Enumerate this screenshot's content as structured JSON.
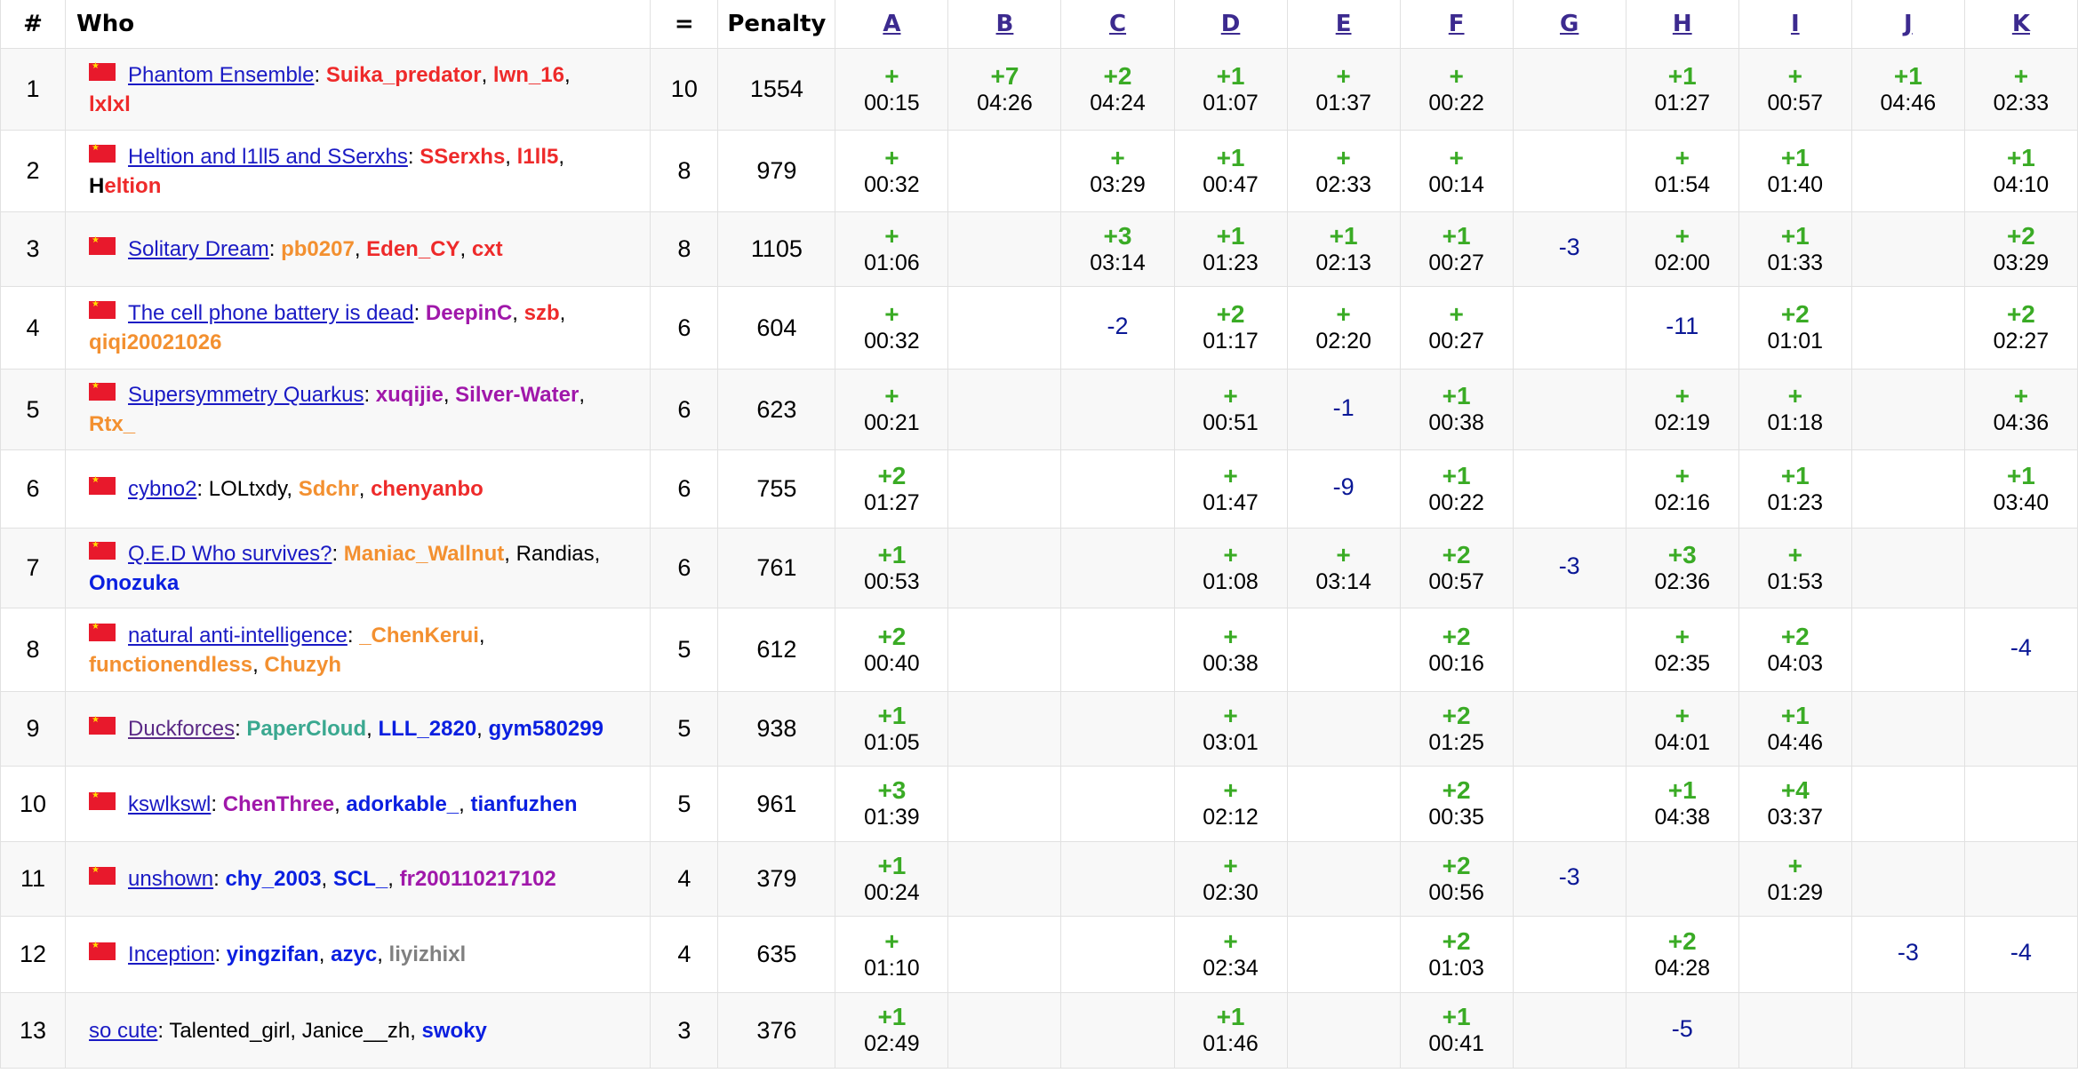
{
  "header": {
    "rank": "#",
    "who": "Who",
    "solved": "=",
    "penalty": "Penalty",
    "problems": [
      "A",
      "B",
      "C",
      "D",
      "E",
      "F",
      "G",
      "H",
      "I",
      "J",
      "K"
    ]
  },
  "colors": {
    "accepted": "#3aab25",
    "rejected": "#0a1896",
    "team_link": "#1a1ac4",
    "row_alt": "#f8f8f8"
  },
  "icons": {
    "flag": "china-flag-icon"
  },
  "rows": [
    {
      "rank": "1",
      "flag": true,
      "team": "Phantom Ensemble",
      "members": [
        {
          "name": "Suika_predator",
          "color": "red"
        },
        {
          "name": "lwn_16",
          "color": "red"
        },
        {
          "name": "lxlxl",
          "color": "red"
        }
      ],
      "line_break_after": 1,
      "solved": "10",
      "penalty": "1554",
      "cells": [
        {
          "r": "+",
          "t": "00:15"
        },
        {
          "r": "+7",
          "t": "04:26"
        },
        {
          "r": "+2",
          "t": "04:24"
        },
        {
          "r": "+1",
          "t": "01:07"
        },
        {
          "r": "+",
          "t": "01:37"
        },
        {
          "r": "+",
          "t": "00:22"
        },
        null,
        {
          "r": "+1",
          "t": "01:27"
        },
        {
          "r": "+",
          "t": "00:57"
        },
        {
          "r": "+1",
          "t": "04:46"
        },
        {
          "r": "+",
          "t": "02:33"
        }
      ]
    },
    {
      "rank": "2",
      "flag": true,
      "team": "Heltion and l1ll5 and SSerxhs",
      "members": [
        {
          "name": "SSerxhs",
          "color": "red"
        },
        {
          "name": "l1ll5",
          "color": "red"
        },
        {
          "name": "Heltion",
          "color": "black-first-red"
        }
      ],
      "line_break_after": 1,
      "solved": "8",
      "penalty": "979",
      "cells": [
        {
          "r": "+",
          "t": "00:32"
        },
        null,
        {
          "r": "+",
          "t": "03:29"
        },
        {
          "r": "+1",
          "t": "00:47"
        },
        {
          "r": "+",
          "t": "02:33"
        },
        {
          "r": "+",
          "t": "00:14"
        },
        null,
        {
          "r": "+",
          "t": "01:54"
        },
        {
          "r": "+1",
          "t": "01:40"
        },
        null,
        {
          "r": "+1",
          "t": "04:10"
        }
      ]
    },
    {
      "rank": "3",
      "flag": true,
      "team": "Solitary Dream",
      "members": [
        {
          "name": "pb0207",
          "color": "orange"
        },
        {
          "name": "Eden_CY",
          "color": "red"
        },
        {
          "name": "cxt",
          "color": "red"
        }
      ],
      "line_break_after": -1,
      "solved": "8",
      "penalty": "1105",
      "cells": [
        {
          "r": "+",
          "t": "01:06"
        },
        null,
        {
          "r": "+3",
          "t": "03:14"
        },
        {
          "r": "+1",
          "t": "01:23"
        },
        {
          "r": "+1",
          "t": "02:13"
        },
        {
          "r": "+1",
          "t": "00:27"
        },
        {
          "n": "-3"
        },
        {
          "r": "+",
          "t": "02:00"
        },
        {
          "r": "+1",
          "t": "01:33"
        },
        null,
        {
          "r": "+2",
          "t": "03:29"
        }
      ]
    },
    {
      "rank": "4",
      "flag": true,
      "team": "The cell phone battery is dead",
      "members": [
        {
          "name": "DeepinC",
          "color": "purple"
        },
        {
          "name": "szb",
          "color": "red"
        },
        {
          "name": "qiqi20021026",
          "color": "orange"
        }
      ],
      "line_break_after": 1,
      "solved": "6",
      "penalty": "604",
      "cells": [
        {
          "r": "+",
          "t": "00:32"
        },
        null,
        {
          "n": "-2"
        },
        {
          "r": "+2",
          "t": "01:17"
        },
        {
          "r": "+",
          "t": "02:20"
        },
        {
          "r": "+",
          "t": "00:27"
        },
        null,
        {
          "n": "-11"
        },
        {
          "r": "+2",
          "t": "01:01"
        },
        null,
        {
          "r": "+2",
          "t": "02:27"
        }
      ]
    },
    {
      "rank": "5",
      "flag": true,
      "team": "Supersymmetry Quarkus",
      "members": [
        {
          "name": "xuqijie",
          "color": "purple"
        },
        {
          "name": "Silver-Water",
          "color": "purple"
        },
        {
          "name": "Rtx_",
          "color": "orange"
        }
      ],
      "line_break_after": 1,
      "solved": "6",
      "penalty": "623",
      "cells": [
        {
          "r": "+",
          "t": "00:21"
        },
        null,
        null,
        {
          "r": "+",
          "t": "00:51"
        },
        {
          "n": "-1"
        },
        {
          "r": "+1",
          "t": "00:38"
        },
        null,
        {
          "r": "+",
          "t": "02:19"
        },
        {
          "r": "+",
          "t": "01:18"
        },
        null,
        {
          "r": "+",
          "t": "04:36"
        }
      ]
    },
    {
      "rank": "6",
      "flag": true,
      "team": "cybno2",
      "members": [
        {
          "name": "LOLtxdy",
          "color": "black"
        },
        {
          "name": "Sdchr",
          "color": "orange"
        },
        {
          "name": "chenyanbo",
          "color": "red"
        }
      ],
      "line_break_after": -1,
      "solved": "6",
      "penalty": "755",
      "cells": [
        {
          "r": "+2",
          "t": "01:27"
        },
        null,
        null,
        {
          "r": "+",
          "t": "01:47"
        },
        {
          "n": "-9"
        },
        {
          "r": "+1",
          "t": "00:22"
        },
        null,
        {
          "r": "+",
          "t": "02:16"
        },
        {
          "r": "+1",
          "t": "01:23"
        },
        null,
        {
          "r": "+1",
          "t": "03:40"
        }
      ]
    },
    {
      "rank": "7",
      "flag": true,
      "team": "Q.E.D Who survives?",
      "members": [
        {
          "name": "Maniac_Wallnut",
          "color": "orange"
        },
        {
          "name": "Randias",
          "color": "black"
        },
        {
          "name": "Onozuka",
          "color": "blue"
        }
      ],
      "line_break_after": 1,
      "solved": "6",
      "penalty": "761",
      "cells": [
        {
          "r": "+1",
          "t": "00:53"
        },
        null,
        null,
        {
          "r": "+",
          "t": "01:08"
        },
        {
          "r": "+",
          "t": "03:14"
        },
        {
          "r": "+2",
          "t": "00:57"
        },
        {
          "n": "-3"
        },
        {
          "r": "+3",
          "t": "02:36"
        },
        {
          "r": "+",
          "t": "01:53"
        },
        null,
        null
      ]
    },
    {
      "rank": "8",
      "flag": true,
      "team": "natural anti-intelligence",
      "members": [
        {
          "name": "_ChenKerui",
          "color": "orange"
        },
        {
          "name": "functionendless",
          "color": "orange"
        },
        {
          "name": "Chuzyh",
          "color": "orange"
        }
      ],
      "line_break_after": 0,
      "solved": "5",
      "penalty": "612",
      "cells": [
        {
          "r": "+2",
          "t": "00:40"
        },
        null,
        null,
        {
          "r": "+",
          "t": "00:38"
        },
        null,
        {
          "r": "+2",
          "t": "00:16"
        },
        null,
        {
          "r": "+",
          "t": "02:35"
        },
        {
          "r": "+2",
          "t": "04:03"
        },
        null,
        {
          "n": "-4"
        }
      ]
    },
    {
      "rank": "9",
      "flag": true,
      "team": "Duckforces",
      "visited": true,
      "members": [
        {
          "name": "PaperCloud",
          "color": "teal"
        },
        {
          "name": "LLL_2820",
          "color": "blue"
        },
        {
          "name": "gym580299",
          "color": "blue"
        }
      ],
      "line_break_after": -1,
      "solved": "5",
      "penalty": "938",
      "cells": [
        {
          "r": "+1",
          "t": "01:05"
        },
        null,
        null,
        {
          "r": "+",
          "t": "03:01"
        },
        null,
        {
          "r": "+2",
          "t": "01:25"
        },
        null,
        {
          "r": "+",
          "t": "04:01"
        },
        {
          "r": "+1",
          "t": "04:46"
        },
        null,
        null
      ]
    },
    {
      "rank": "10",
      "flag": true,
      "team": "kswlkswl",
      "members": [
        {
          "name": "ChenThree",
          "color": "purple"
        },
        {
          "name": "adorkable_",
          "color": "blue"
        },
        {
          "name": "tianfuzhen",
          "color": "blue"
        }
      ],
      "line_break_after": -1,
      "solved": "5",
      "penalty": "961",
      "cells": [
        {
          "r": "+3",
          "t": "01:39"
        },
        null,
        null,
        {
          "r": "+",
          "t": "02:12"
        },
        null,
        {
          "r": "+2",
          "t": "00:35"
        },
        null,
        {
          "r": "+1",
          "t": "04:38"
        },
        {
          "r": "+4",
          "t": "03:37"
        },
        null,
        null
      ]
    },
    {
      "rank": "11",
      "flag": true,
      "team": "unshown",
      "members": [
        {
          "name": "chy_2003",
          "color": "blue"
        },
        {
          "name": "SCL_",
          "color": "blue"
        },
        {
          "name": "fr200110217102",
          "color": "purple"
        }
      ],
      "line_break_after": -1,
      "solved": "4",
      "penalty": "379",
      "cells": [
        {
          "r": "+1",
          "t": "00:24"
        },
        null,
        null,
        {
          "r": "+",
          "t": "02:30"
        },
        null,
        {
          "r": "+2",
          "t": "00:56"
        },
        {
          "n": "-3"
        },
        null,
        {
          "r": "+",
          "t": "01:29"
        },
        null,
        null
      ]
    },
    {
      "rank": "12",
      "flag": true,
      "team": "Inception",
      "members": [
        {
          "name": "yingzifan",
          "color": "blue"
        },
        {
          "name": "azyc",
          "color": "blue"
        },
        {
          "name": "liyizhixl",
          "color": "gray"
        }
      ],
      "line_break_after": -1,
      "solved": "4",
      "penalty": "635",
      "cells": [
        {
          "r": "+",
          "t": "01:10"
        },
        null,
        null,
        {
          "r": "+",
          "t": "02:34"
        },
        null,
        {
          "r": "+2",
          "t": "01:03"
        },
        null,
        {
          "r": "+2",
          "t": "04:28"
        },
        null,
        {
          "n": "-3"
        },
        {
          "n": "-4"
        }
      ]
    },
    {
      "rank": "13",
      "flag": false,
      "team": "so cute",
      "members": [
        {
          "name": "Talented_girl",
          "color": "black"
        },
        {
          "name": "Janice__zh",
          "color": "black"
        },
        {
          "name": "swoky",
          "color": "blue"
        }
      ],
      "line_break_after": -1,
      "solved": "3",
      "penalty": "376",
      "cells": [
        {
          "r": "+1",
          "t": "02:49"
        },
        null,
        null,
        {
          "r": "+1",
          "t": "01:46"
        },
        null,
        {
          "r": "+1",
          "t": "00:41"
        },
        null,
        {
          "n": "-5"
        },
        null,
        null,
        null
      ]
    }
  ]
}
